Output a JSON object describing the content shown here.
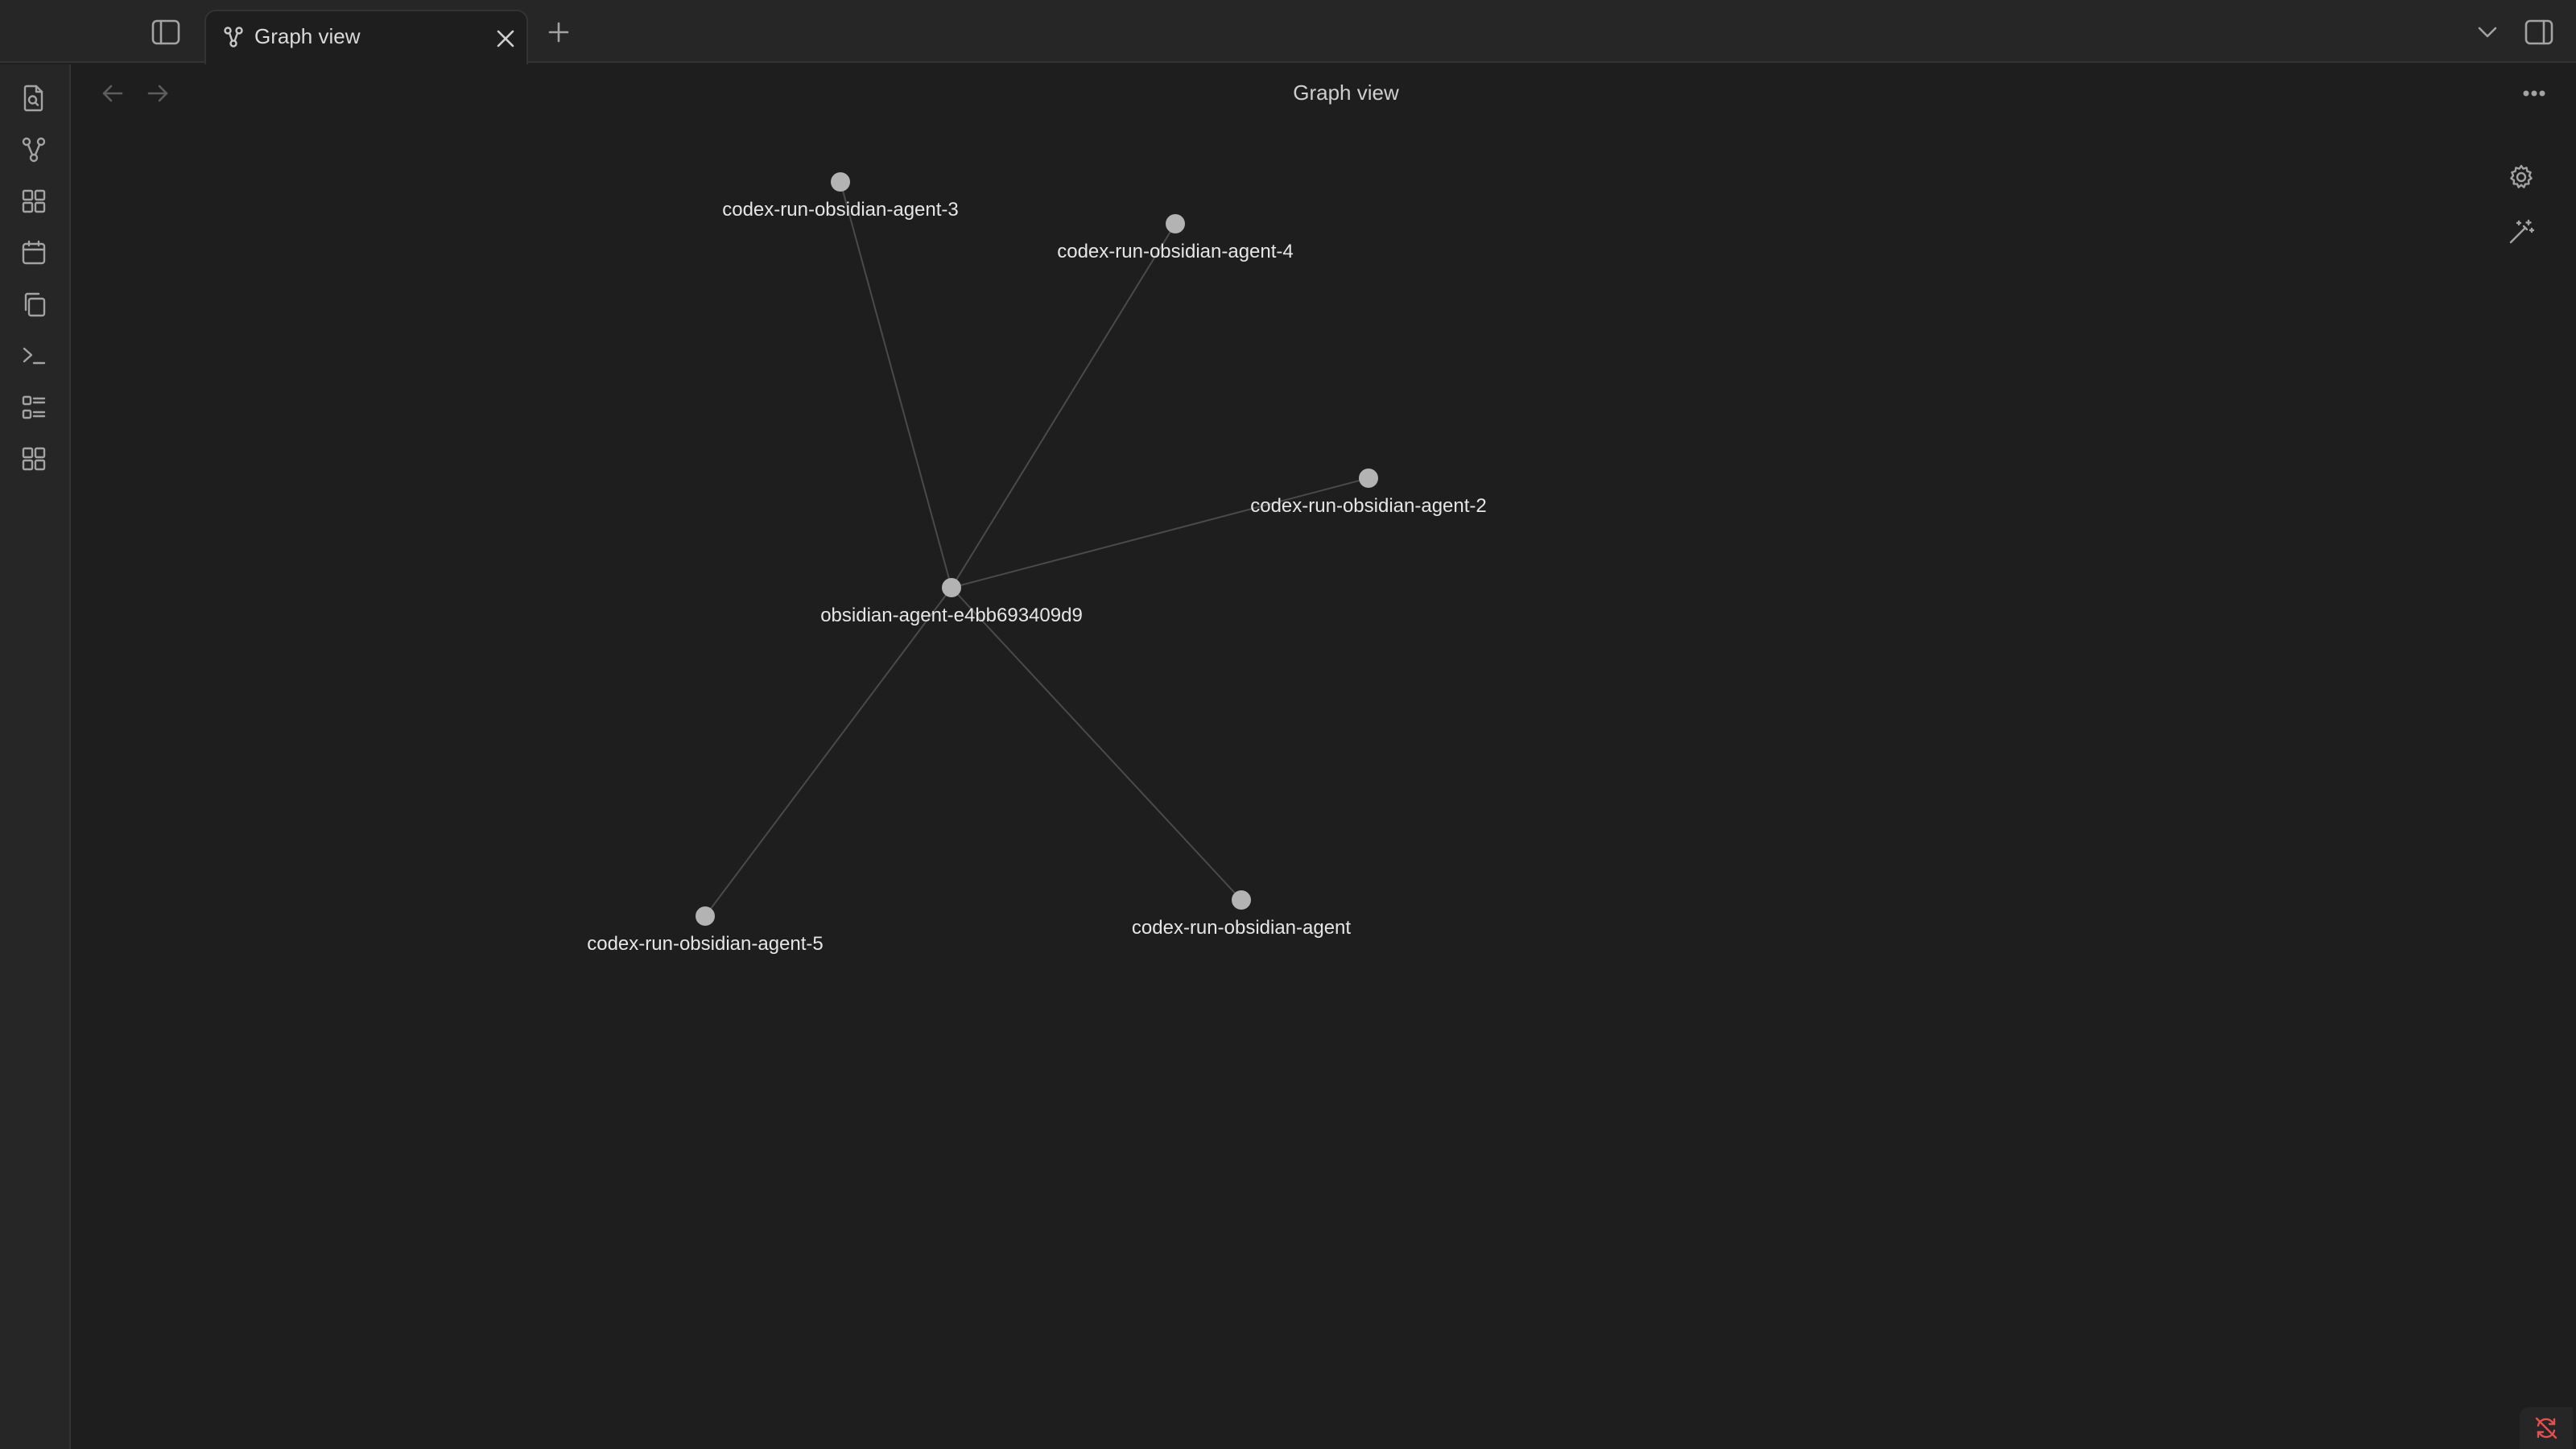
{
  "tab": {
    "title": "Graph view",
    "icon": "graph-icon"
  },
  "view": {
    "title": "Graph view"
  },
  "ribbon": {
    "items": [
      {
        "name": "open-quick-switcher",
        "icon": "file-search-icon"
      },
      {
        "name": "open-graph-view",
        "icon": "graph-icon"
      },
      {
        "name": "open-canvas",
        "icon": "layout-dashboard-icon"
      },
      {
        "name": "open-daily-note",
        "icon": "calendar-icon"
      },
      {
        "name": "insert-template",
        "icon": "copy-icon"
      },
      {
        "name": "open-command-palette",
        "icon": "terminal-icon"
      },
      {
        "name": "bases",
        "icon": "list-icon"
      },
      {
        "name": "open-canvas-alt",
        "icon": "layout-dashboard-icon"
      }
    ]
  },
  "graph": {
    "nodes": [
      {
        "id": "center",
        "label": "obsidian-agent-e4bb693409d9"
      },
      {
        "id": "a3",
        "label": "codex-run-obsidian-agent-3"
      },
      {
        "id": "a4",
        "label": "codex-run-obsidian-agent-4"
      },
      {
        "id": "a2",
        "label": "codex-run-obsidian-agent-2"
      },
      {
        "id": "a5",
        "label": "codex-run-obsidian-agent-5"
      },
      {
        "id": "a1",
        "label": "codex-run-obsidian-agent"
      }
    ],
    "edges": [
      [
        "center",
        "a3"
      ],
      [
        "center",
        "a4"
      ],
      [
        "center",
        "a2"
      ],
      [
        "center",
        "a5"
      ],
      [
        "center",
        "a1"
      ]
    ]
  },
  "colors": {
    "background": "#1e1e1e",
    "node": "#b3b3b3",
    "edge": "#4a4a4a",
    "label": "#e6e6e6",
    "sync_status": "#e05252"
  }
}
